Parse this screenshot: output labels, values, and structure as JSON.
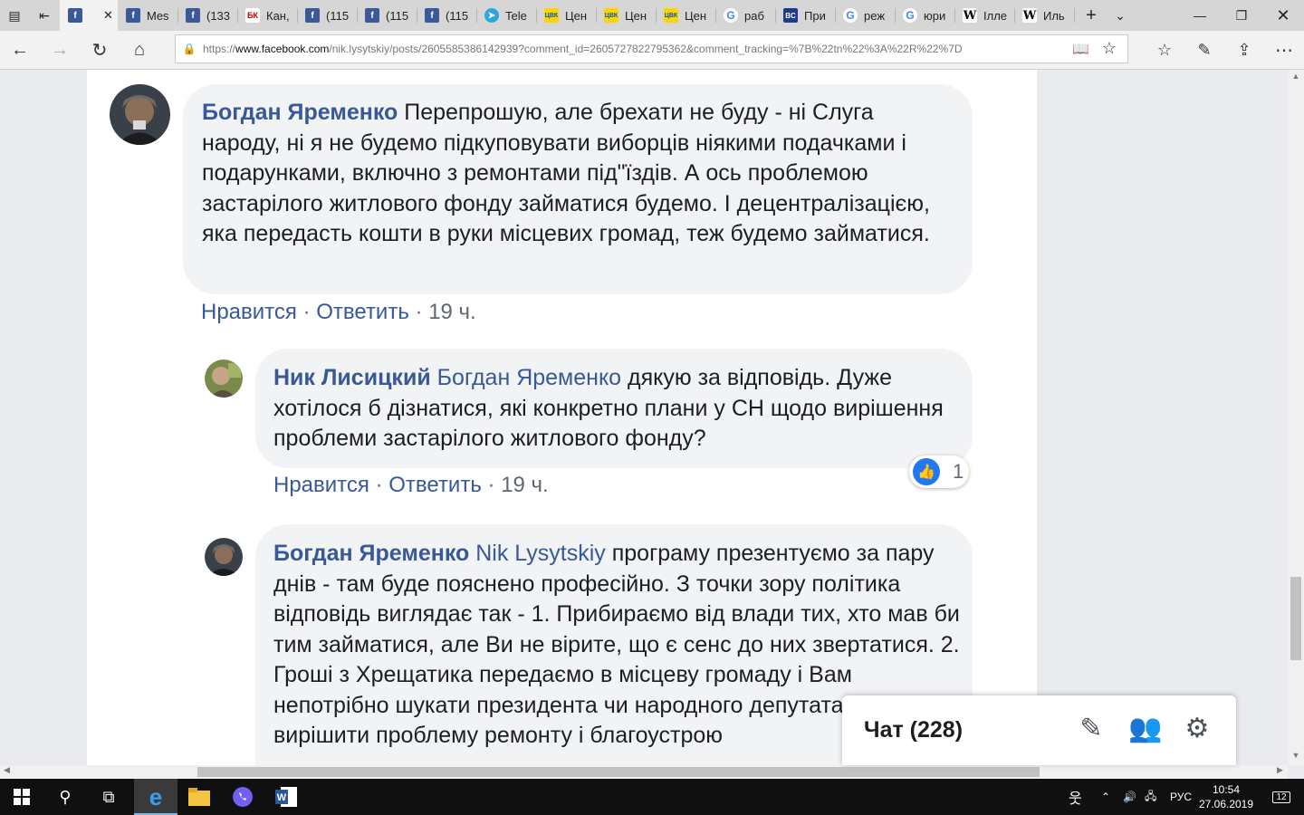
{
  "tabs": [
    {
      "favicon": "facebook-icon",
      "label": ""
    },
    {
      "favicon": "facebook-icon",
      "label": "Mes"
    },
    {
      "favicon": "facebook-icon",
      "label": "(133"
    },
    {
      "favicon": "bk-icon",
      "label": "Кан,"
    },
    {
      "favicon": "facebook-icon",
      "label": "(115"
    },
    {
      "favicon": "facebook-icon",
      "label": "(115"
    },
    {
      "favicon": "facebook-icon",
      "label": "(115"
    },
    {
      "favicon": "telegram-icon",
      "label": "Tele"
    },
    {
      "favicon": "cvk-icon",
      "label": "Цен"
    },
    {
      "favicon": "cvk-icon",
      "label": "Цен"
    },
    {
      "favicon": "cvk-icon",
      "label": "Цен"
    },
    {
      "favicon": "google-icon",
      "label": "раб"
    },
    {
      "favicon": "vc-icon",
      "label": "При"
    },
    {
      "favicon": "google-icon",
      "label": "реж"
    },
    {
      "favicon": "google-icon",
      "label": "юри"
    },
    {
      "favicon": "wikipedia-icon",
      "label": "Ілле"
    },
    {
      "favicon": "wikipedia-icon",
      "label": "Иль"
    }
  ],
  "address": {
    "prefix": "https://",
    "host": "www.facebook.com",
    "path": "/nik.lysytskiy/posts/2605585386142939?comment_id=2605727822795362&comment_tracking=%7B%22tn%22%3A%22R%22%7D"
  },
  "comments": {
    "c1": {
      "author": "Богдан Яременко",
      "text": "Перепрошую, але брехати не буду - ні Слуга народу, ні я не будемо підкуповувати виборців ніякими подачками і подарунками, включно з ремонтами під\"їздів. А ось проблемою застарілого житлового фонду займатися будемо. І децентралізацією, яка передасть кошти в руки місцевих громад, теж будемо займатися.",
      "like": "Нравится",
      "reply": "Ответить",
      "time": "19 ч."
    },
    "c2": {
      "author": "Ник Лисицкий",
      "mention": "Богдан Яременко",
      "text": "дякую за відповідь. Дуже хотілося б дізнатися, які конкретно плани у СН щодо вирішення проблеми застарілого житлового фонду?",
      "like": "Нравится",
      "reply": "Ответить",
      "time": "19 ч.",
      "reactions": "1"
    },
    "c3": {
      "author": "Богдан Яременко",
      "mention": "Nik Lysytskiy",
      "text": "програму презентуємо за пару днів - там буде пояснено професійно. З точки зору політика відповідь виглядає так - 1. Прибираємо від влади тих, хто мав би тим займатися, але Ви не вірите, що є сенс до них звертатися. 2. Гроші з Хрещатика передаємо в місцеву громаду і Вам непотрібно шукати президента чи народного депутата, щоб вирішити проблему ремонту і благоустрою"
    }
  },
  "chat": {
    "title": "Чат (228)"
  },
  "taskbar": {
    "lang": "РУС",
    "time": "10:54",
    "date": "27.06.2019",
    "notifications": "12"
  }
}
